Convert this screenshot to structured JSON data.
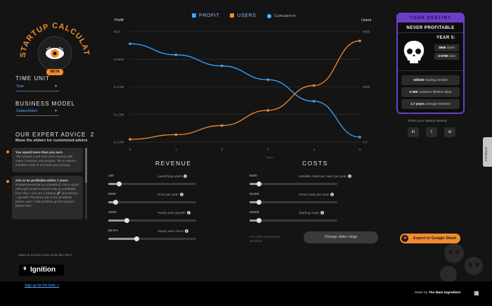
{
  "sidebar": {
    "logo_text": "STARTUP CALCULATOR",
    "logo_badge": "BETA",
    "time_unit_label": "TIME UNIT",
    "time_unit_value": "Year",
    "business_model_label": "BUSINESS MODEL",
    "business_model_value": "Subscription",
    "advice_title": "OUR EXPERT ADVICE",
    "advice_count": "2",
    "advice_subtitle": "Move the sliders for customized advice",
    "advice_cards": [
      {
        "head": "You spend more than you earn",
        "body": "This means you'll lose more money with every customer you acquire. Try to reduce variable costs or increase your pricing."
      },
      {
        "head": "Aim to be profitable within 7 years",
        "body": "Entrepreneurship is a marathon, not a sprint. Although small business may be profitable from day 1 you are a startup 🚀 and startup = growth! Therefore aim to be profitable before year 7 with positive gross margins before that."
      }
    ],
    "promo_text": "Want to access more tools like this?",
    "ignition_label": "Ignition",
    "signup_link": "Sign up for the beta ↗"
  },
  "chart": {
    "legend": {
      "profit": "PROFIT",
      "users": "USERS",
      "cumulative": "Cumulative"
    },
    "colors": {
      "profit": "#3aa6ff",
      "users": "#f28b2c",
      "cumulative": "#4fb8ff"
    }
  },
  "chart_data": {
    "type": "line",
    "x": [
      0,
      1,
      2,
      3,
      4,
      5
    ],
    "xlabel": "Years",
    "xticks": [
      "0",
      "1",
      "2",
      "3",
      "4",
      "5"
    ],
    "left_axis": {
      "title": "Profit",
      "ticks": [
        "€0.0",
        "€-500K",
        "€-1.0M",
        "€-1.5M",
        "€-2.0M"
      ],
      "ylim": [
        -2000000,
        0
      ]
    },
    "right_axis": {
      "title": "Users",
      "ticks": [
        "4000",
        "2000",
        "0.0"
      ],
      "ylim": [
        0,
        4000
      ]
    },
    "series": [
      {
        "name": "PROFIT",
        "axis": "left",
        "values": [
          -220000,
          -420000,
          -620000,
          -870000,
          -1260000,
          -1910000
        ]
      },
      {
        "name": "USERS",
        "axis": "right",
        "values": [
          100,
          270,
          600,
          1150,
          2050,
          3665
        ]
      }
    ]
  },
  "revenue": {
    "title": "REVENUE",
    "sliders": [
      {
        "label": "Launching users",
        "value": "100",
        "level": 0.12
      },
      {
        "label": "Price per year",
        "value": "€250",
        "level": 0.08
      },
      {
        "label": "Yearly user growth",
        "value": "100%",
        "level": 0.21
      },
      {
        "label": "Yearly user churn",
        "value": "80.0%",
        "level": 0.32
      }
    ]
  },
  "costs": {
    "title": "COSTS",
    "sliders": [
      {
        "label": "Variable costs per user per year",
        "value": "€400",
        "level": 0.1
      },
      {
        "label": "Fixed costs per year",
        "value": "€120K",
        "level": 0.1
      },
      {
        "label": "Starting costs",
        "value": "€250K",
        "level": 0.1
      }
    ],
    "more_control": "For more control and precision",
    "change_range_button": "Change slider range"
  },
  "destiny": {
    "header": "YOUR DESTINY",
    "verdict": "NEVER PROFITABLE",
    "year_label": "YEAR 5:",
    "users_value": "3665",
    "users_unit": "users",
    "loss_value": "€-670K",
    "loss_unit": "loss",
    "funding_value": "Infinite",
    "funding_unit": "funding needed",
    "ltv_value": "€-260",
    "ltv_unit": "customer lifetime value",
    "retention_value": "1.7 years",
    "retention_unit": "average retention"
  },
  "share": {
    "label": "Share your startup destiny",
    "linkedin": "in",
    "twitter": "t",
    "whatsapp": "w"
  },
  "export_button": "Export to Google Sheet",
  "feedback_tab": "Feedback",
  "footer": {
    "made_by_prefix": "Made by",
    "made_by_brand": "The Main Ingredient"
  }
}
